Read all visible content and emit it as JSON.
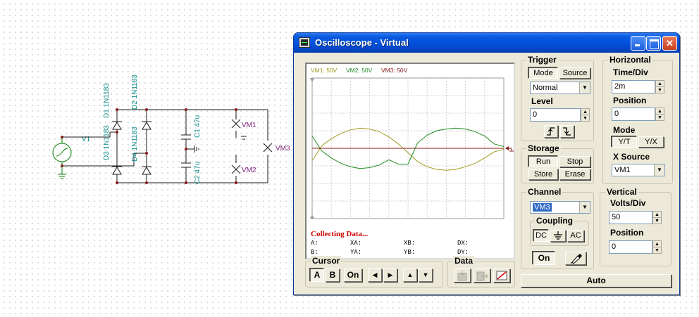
{
  "schematic": {
    "source_label": "V1",
    "diodes": [
      {
        "label": "D1 1N1183"
      },
      {
        "label": "D2 1N1183"
      },
      {
        "label": "D3 1N1183"
      },
      {
        "label": "D4 1N1183"
      }
    ],
    "capacitors": [
      {
        "label": "C1 47u"
      },
      {
        "label": "C2 47u"
      }
    ],
    "voltmeters": [
      "VM1",
      "VM2",
      "VM3"
    ],
    "colors": {
      "wire": "#1a1a1a",
      "source": "#007d00",
      "label": "#0a8a8a",
      "meter": "#7a1a7a",
      "node": "#8b1a1a"
    }
  },
  "window": {
    "title": "Oscilloscope - Virtual",
    "icon": "oscilloscope-icon",
    "caption_buttons": [
      "minimize-icon",
      "maximize-icon",
      "close-icon"
    ]
  },
  "scope": {
    "legend": [
      {
        "text": "VM1: 50V",
        "color": "#a29a1f"
      },
      {
        "text": "VM2: 50V",
        "color": "#1f8a1f"
      },
      {
        "text": "VM3: 50V",
        "color": "#8b1a1a"
      }
    ],
    "status": "Collecting Data...",
    "status_color": "#d00000",
    "readouts": {
      "a": "A:",
      "b": "B:",
      "xa": "XA:",
      "ya": "YA:",
      "xb": "XB:",
      "yb": "YB:",
      "dx": "DX:",
      "dy": "DY:"
    }
  },
  "chart_data": {
    "type": "line",
    "x_unit": "divisions",
    "y_unit": "divisions",
    "xlim": [
      0,
      10
    ],
    "ylim": [
      -4,
      4
    ],
    "grid": true,
    "series": [
      {
        "name": "VM1: 50V",
        "color": "#a29a1f",
        "x": [
          0,
          0.5,
          1,
          1.5,
          2,
          2.5,
          3,
          3.5,
          4,
          4.5,
          5,
          5.5,
          6,
          6.5,
          7,
          7.5,
          8,
          8.5,
          9,
          9.5,
          10
        ],
        "y": [
          -0.7,
          0.15,
          0.55,
          0.85,
          1.05,
          1.15,
          1.1,
          0.95,
          0.65,
          0.25,
          -0.25,
          -0.75,
          -1.05,
          -1.2,
          -1.25,
          -1.2,
          -1.05,
          -0.85,
          -0.55,
          -0.2,
          -0.05
        ]
      },
      {
        "name": "VM2: 50V",
        "color": "#1f8a1f",
        "x": [
          0,
          0.5,
          1,
          1.5,
          2,
          2.5,
          3,
          3.5,
          4,
          4.5,
          5,
          5.5,
          6,
          6.5,
          7,
          7.5,
          8,
          8.5,
          9,
          9.5,
          10
        ],
        "y": [
          0.7,
          -0.15,
          -0.55,
          -0.85,
          -1.05,
          -1.15,
          -1.1,
          -0.95,
          -0.65,
          -0.9,
          -0.9,
          0.3,
          0.75,
          1.0,
          1.1,
          1.15,
          1.1,
          0.95,
          0.7,
          0.25,
          0.1
        ]
      },
      {
        "name": "VM3: 50V",
        "color": "#8b1a1a",
        "x": [
          0,
          10
        ],
        "y": [
          0,
          0
        ]
      }
    ]
  },
  "trigger": {
    "title": "Trigger",
    "mode_label": "Mode",
    "source_label": "Source",
    "mode_value": "Normal",
    "level_label": "Level",
    "level_value": "0",
    "edge_icons": [
      "rising-edge-icon",
      "falling-edge-icon"
    ]
  },
  "horizontal": {
    "title": "Horizontal",
    "time_div_label": "Time/Div",
    "time_div_value": "2m",
    "position_label": "Position",
    "position_value": "0",
    "mode_label": "Mode",
    "yt_label": "Y/T",
    "yx_label": "Y/X",
    "xsource_label": "X Source",
    "xsource_value": "VM1"
  },
  "storage": {
    "title": "Storage",
    "run": "Run",
    "stop": "Stop",
    "store": "Store",
    "erase": "Erase"
  },
  "channel": {
    "title": "Channel",
    "value": "VM3",
    "coupling_label": "Coupling",
    "dc": "DC",
    "gnd_icon": "ground-icon",
    "ac": "AC",
    "on": "On",
    "color_icon": "color-picker-icon"
  },
  "vertical": {
    "title": "Vertical",
    "volts_div_label": "Volts/Div",
    "volts_div_value": "50",
    "position_label": "Position",
    "position_value": "0"
  },
  "cursor": {
    "title": "Cursor",
    "a": "A",
    "b": "B",
    "on": "On",
    "arrows": [
      "left-arrow-icon",
      "right-arrow-icon",
      "up-arrow-icon",
      "down-arrow-icon"
    ]
  },
  "data": {
    "title": "Data",
    "icons": [
      "import-icon",
      "export-icon",
      "clear-icon"
    ]
  },
  "auto_label": "Auto"
}
